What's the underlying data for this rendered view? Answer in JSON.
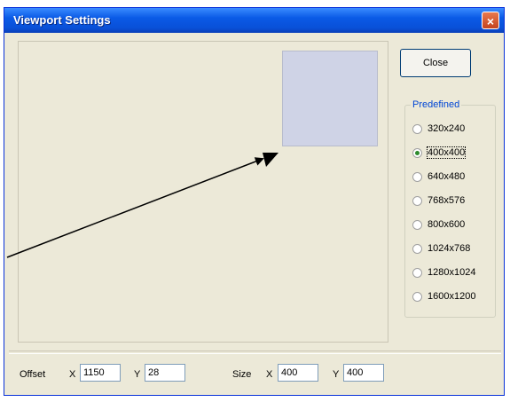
{
  "window": {
    "title": "Viewport Settings",
    "close_glyph": "×"
  },
  "buttons": {
    "close_label": "Close"
  },
  "predefined": {
    "label": "Predefined",
    "options": [
      "320x240",
      "400x400",
      "640x480",
      "768x576",
      "800x600",
      "1024x768",
      "1280x1024",
      "1600x1200"
    ],
    "selected_index": 1
  },
  "offset": {
    "label": "Offset",
    "x_label": "X",
    "x_value": "1150",
    "y_label": "Y",
    "y_value": "28"
  },
  "size": {
    "label": "Size",
    "x_label": "X",
    "x_value": "400",
    "y_label": "Y",
    "y_value": "400"
  },
  "colors": {
    "titlebar": "#0a5ae6",
    "preview": "#cfd3e6",
    "window_bg": "#ece9d8",
    "radio_dot": "#2c8a2c"
  }
}
